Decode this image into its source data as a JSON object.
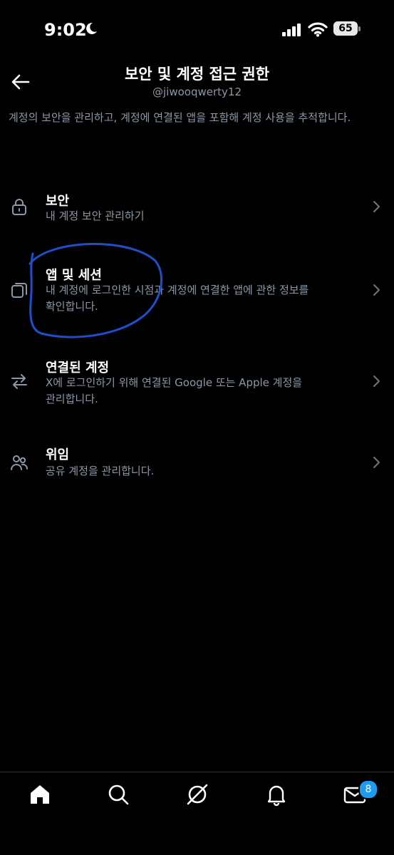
{
  "status": {
    "time": "9:02",
    "battery": "65"
  },
  "header": {
    "title": "보안 및 계정 접근 권한",
    "handle": "@jiwooqwerty12",
    "description": "계정의 보안을 관리하고, 계정에 연결된 앱을 포함해 계정 사용을 추적합니다."
  },
  "items": [
    {
      "title": "보안",
      "subtitle": "내 계정 보안 관리하기",
      "icon": "lock-icon"
    },
    {
      "title": "앱 및 세션",
      "subtitle": "내 계정에 로그인한 시점과 계정에 연결한 앱에 관한 정보를 확인합니다.",
      "icon": "copy-icon"
    },
    {
      "title": "연결된 계정",
      "subtitle": "X에 로그인하기 위해 연결된 Google 또는 Apple 계정을 관리합니다.",
      "icon": "arrows-swap-icon"
    },
    {
      "title": "위임",
      "subtitle": "공유 계정을 관리합니다.",
      "icon": "people-icon"
    }
  ],
  "nav": {
    "messages_badge": "8"
  },
  "annotation_color": "#1f4fc8"
}
